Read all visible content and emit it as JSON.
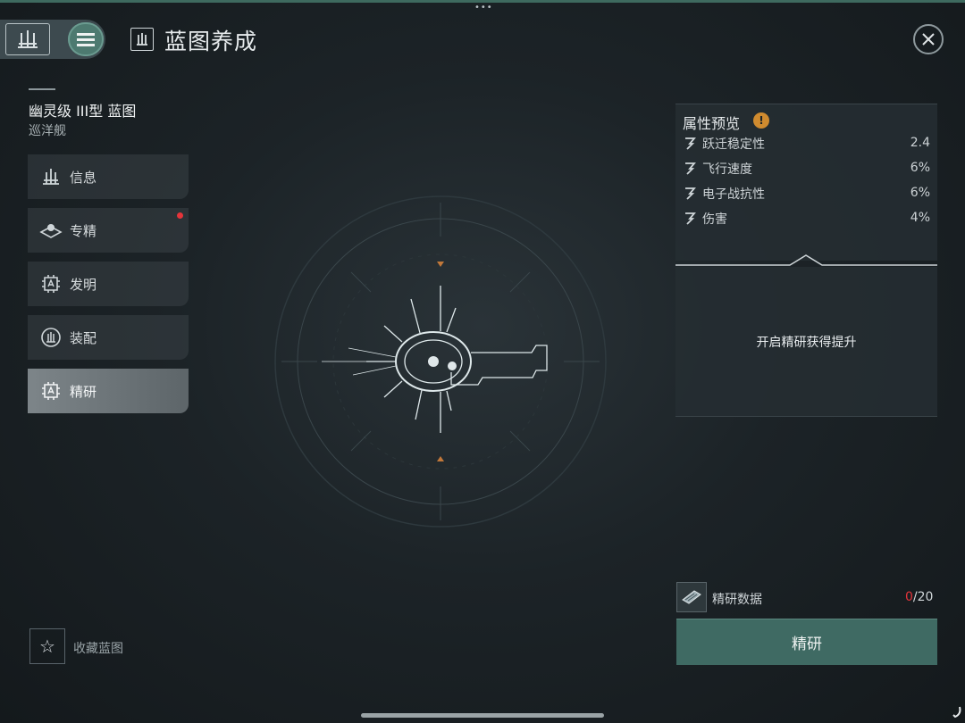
{
  "header": {
    "title": "蓝图养成",
    "top_dots": "•••"
  },
  "blueprint": {
    "name": "幽灵级 III型 蓝图",
    "class": "巡洋舰"
  },
  "nav_items": [
    {
      "label": "信息",
      "icon": "ship-info-icon"
    },
    {
      "label": "专精",
      "icon": "specialization-icon",
      "has_badge": true
    },
    {
      "label": "发明",
      "icon": "invention-icon"
    },
    {
      "label": "装配",
      "icon": "fitting-icon"
    },
    {
      "label": "精研",
      "icon": "refine-icon",
      "active": true
    }
  ],
  "favorite": {
    "icon": "☆",
    "label": "收藏蓝图"
  },
  "attributes": {
    "title": "属性预览",
    "warn_glyph": "!",
    "rows": [
      {
        "name": "跃迁稳定性",
        "value": "2.4"
      },
      {
        "name": "飞行速度",
        "value": "6%"
      },
      {
        "name": "电子战抗性",
        "value": "6%"
      },
      {
        "name": "伤害",
        "value": "4%"
      }
    ]
  },
  "unlock_text": "开启精研获得提升",
  "material": {
    "name": "精研数据",
    "have": "0",
    "need": "/20"
  },
  "refine_button": "精研",
  "colors": {
    "accent": "#3f6a63",
    "badge": "#e5343a",
    "warn": "#d08b2f"
  }
}
